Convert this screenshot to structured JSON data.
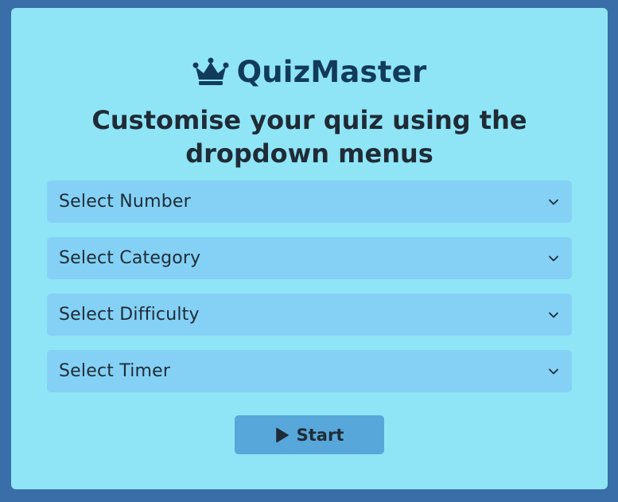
{
  "app": {
    "title": "QuizMaster",
    "logo_icon": "crown-icon"
  },
  "heading": "Customise your quiz using the dropdown menus",
  "selects": [
    {
      "value": "Select Number"
    },
    {
      "value": "Select Category"
    },
    {
      "value": "Select Difficulty"
    },
    {
      "value": "Select Timer"
    }
  ],
  "start_button": {
    "label": "Start",
    "icon": "play-icon"
  },
  "colors": {
    "background": "#3a6ea8",
    "card": "#8fe5f6",
    "select_bg": "#84d1f5",
    "button_bg": "#58a7da",
    "title": "#123a5a",
    "text": "#1f2b36"
  }
}
